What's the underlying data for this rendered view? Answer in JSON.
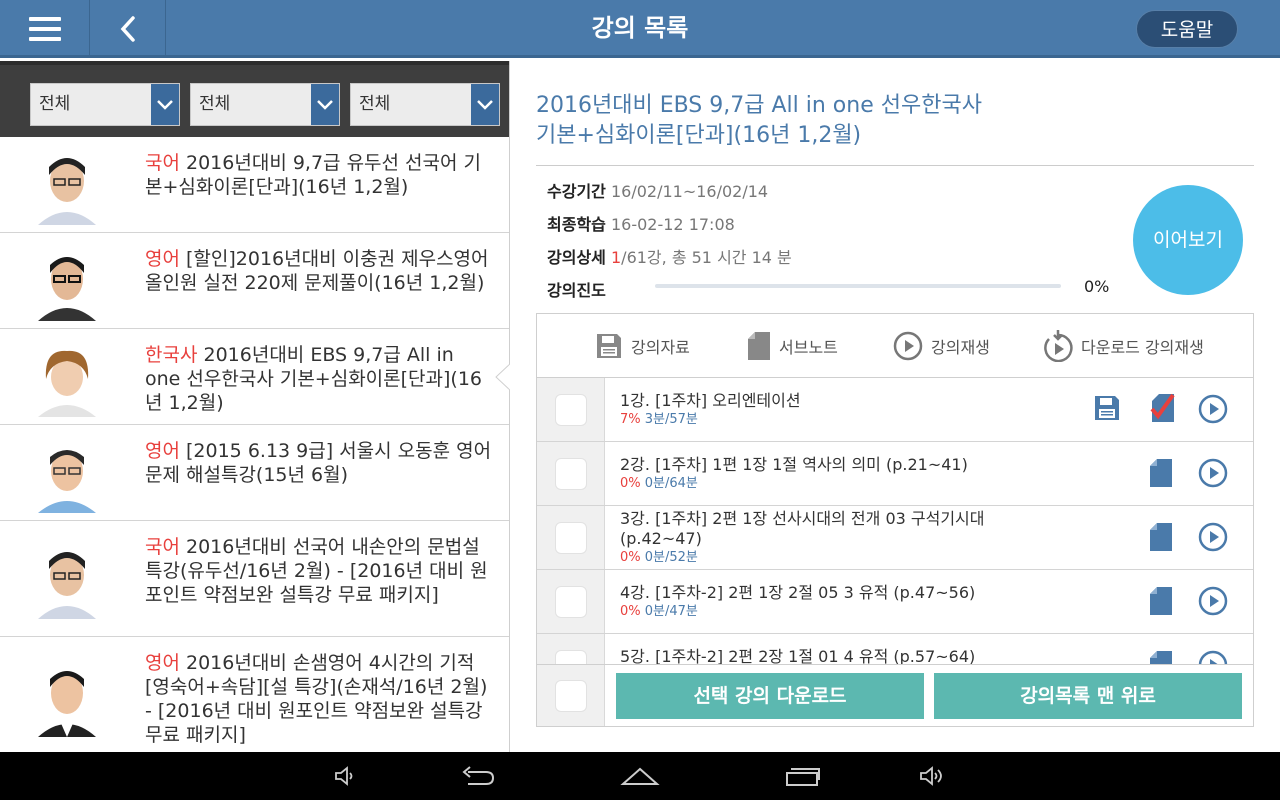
{
  "header": {
    "title": "강의 목록",
    "help_label": "도움말"
  },
  "filters": [
    {
      "value": "전체"
    },
    {
      "value": "전체"
    },
    {
      "value": "전체"
    }
  ],
  "courses": [
    {
      "subject": "국어",
      "text": " 2016년대비 9,7급 유두선 선국어 기본+심화이론[단과](16년 1,2월)"
    },
    {
      "subject": "영어",
      "text": " [할인]2016년대비 이충권 제우스영어 올인원 실전 220제 문제풀이(16년 1,2월)"
    },
    {
      "subject": "한국사",
      "text": " 2016년대비 EBS 9,7급 All in one 선우한국사 기본+심화이론[단과](16년 1,2월)"
    },
    {
      "subject": "영어",
      "text": " [2015 6.13 9급] 서울시 오동훈 영어 문제 해설특강(15년 6월)"
    },
    {
      "subject": "국어",
      "text": " 2016년대비 선국어 내손안의 문법설 특강(유두선/16년 2월) - [2016년 대비 원포인트 약점보완 설특강 무료 패키지]"
    },
    {
      "subject": "영어",
      "text": " 2016년대비 손샘영어 4시간의 기적[영숙어+속담][설 특강](손재석/16년 2월) - [2016년 대비 원포인트 약점보완 설특강 무료 패키지]"
    }
  ],
  "detail": {
    "title_line1": "2016년대비 EBS 9,7급 All in one 선우한국사",
    "title_line2": "기본+심화이론[단과](16년 1,2월)",
    "period_label": "수강기간",
    "period_value": "16/02/11~16/02/14",
    "last_label": "최종학습",
    "last_value": "16-02-12 17:08",
    "detail_label": "강의상세",
    "detail_current": "1",
    "detail_rest": "/61강, 총 51 시간 14 분",
    "progress_label": "강의진도",
    "progress_value": 0,
    "progress_text": "0%",
    "resume_label": "이어보기"
  },
  "table_header": {
    "materials": "강의자료",
    "subnote": "서브노트",
    "play": "강의재생",
    "download_play": "다운로드 강의재생"
  },
  "lectures": [
    {
      "title": "1강. [1주차] 오리엔테이션",
      "pct": "7%",
      "time": " 3분/57분"
    },
    {
      "title": "2강. [1주차] 1편 1장 1절 역사의 의미 (p.21~41)",
      "pct": "0%",
      "time": " 0분/64분"
    },
    {
      "title": "3강. [1주차] 2편 1장 선사시대의 전개 03 구석기시대 (p.42~47)",
      "pct": "0%",
      "time": " 0분/52분"
    },
    {
      "title": "4강. [1주차-2] 2편 1장 2절 05 3 유적 (p.47~56)",
      "pct": "0%",
      "time": " 0분/47분"
    },
    {
      "title": "5강. [1주차-2] 2편 2장 1절 01 4 유적 (p.57~64)",
      "pct": "",
      "time": ""
    }
  ],
  "footer": {
    "download_label": "선택 강의 다운로드",
    "top_label": "강의목록 맨 위로"
  },
  "colors": {
    "brand": "#4a7aaa",
    "accent_red": "#e8403d",
    "resume": "#4cbde8",
    "teal": "#5cb8b0"
  }
}
